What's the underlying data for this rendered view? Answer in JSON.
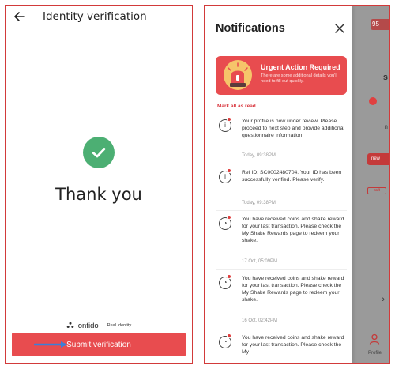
{
  "left_screen": {
    "title": "Identity verification",
    "heading": "Thank you",
    "brand_name": "onfido",
    "brand_tagline": "Real Identity",
    "submit_label": "Submit verification",
    "colors": {
      "accent": "#e84c4f",
      "success": "#4caf73"
    }
  },
  "right_screen": {
    "title": "Notifications",
    "urgent": {
      "title": "Urgent Action Required",
      "body": "There are some additional details you'll need to fill out quickly."
    },
    "mark_all_label": "Mark all as read",
    "notifications": [
      {
        "icon": "info-icon",
        "text": "Your profile is now under review. Please proceed to next step and provide additional questionnaire information",
        "time": "Today, 09:38PM"
      },
      {
        "icon": "info-icon",
        "text": "Ref ID: SC0002480704. Your ID has been successfully verified. Please verify.",
        "time": "Today, 09:38PM"
      },
      {
        "icon": "coin-icon",
        "text": "You have received coins and shake reward for your last transaction. Please check the My Shake Rewards page to redeem your shake.",
        "time": "17 Oct, 05:09PM"
      },
      {
        "icon": "coin-icon",
        "text": "You have received coins and shake reward for your last transaction. Please check the My Shake Rewards page to redeem your shake.",
        "time": "16 Oct, 02:42PM"
      },
      {
        "icon": "coin-icon",
        "text": "You have received coins and shake reward for your last transaction. Please check the My",
        "time": ""
      }
    ],
    "background": {
      "badge": "95",
      "text_s": "s",
      "text_n": "n",
      "red_button": "new",
      "outline_button": "ault",
      "chevron": "›",
      "profile_label": "Profile"
    },
    "colors": {
      "accent": "#e84c4f",
      "unread_dot": "#e03c3c",
      "muted": "#999999"
    }
  }
}
